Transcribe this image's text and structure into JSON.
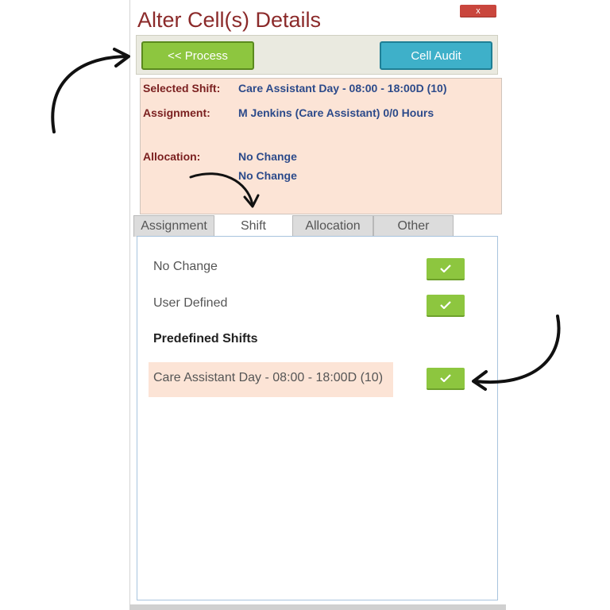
{
  "dialog": {
    "title": "Alter Cell(s) Details",
    "close_symbol": "x"
  },
  "toolbar": {
    "process_label": "<< Process",
    "audit_label": "Cell Audit"
  },
  "details": {
    "selected_shift_label": "Selected Shift:",
    "selected_shift_value": "Care Assistant Day - 08:00 - 18:00D (10)",
    "assignment_label": "Assignment:",
    "assignment_value": "M Jenkins (Care Assistant) 0/0 Hours",
    "allocation_label": "Allocation:",
    "allocation_value_1": "No Change",
    "allocation_value_2": "No Change"
  },
  "tabs": [
    {
      "label": "Assignment"
    },
    {
      "label": "Shift"
    },
    {
      "label": "Allocation"
    },
    {
      "label": "Other"
    }
  ],
  "active_tab": "Shift",
  "shift_options": {
    "no_change": "No Change",
    "user_defined": "User Defined",
    "predefined_heading": "Predefined Shifts",
    "predefined_item": "Care Assistant Day - 08:00 - 18:00D (10)"
  },
  "icons": {
    "check": "check-icon",
    "arrow": "arrow-annotation"
  },
  "colors": {
    "title": "#8b2a2a",
    "process_button": "#8dc63f",
    "audit_button": "#3eb0c9",
    "details_background": "#fce4d6",
    "check_button": "#8dc63f",
    "close_button": "#c9463d"
  }
}
